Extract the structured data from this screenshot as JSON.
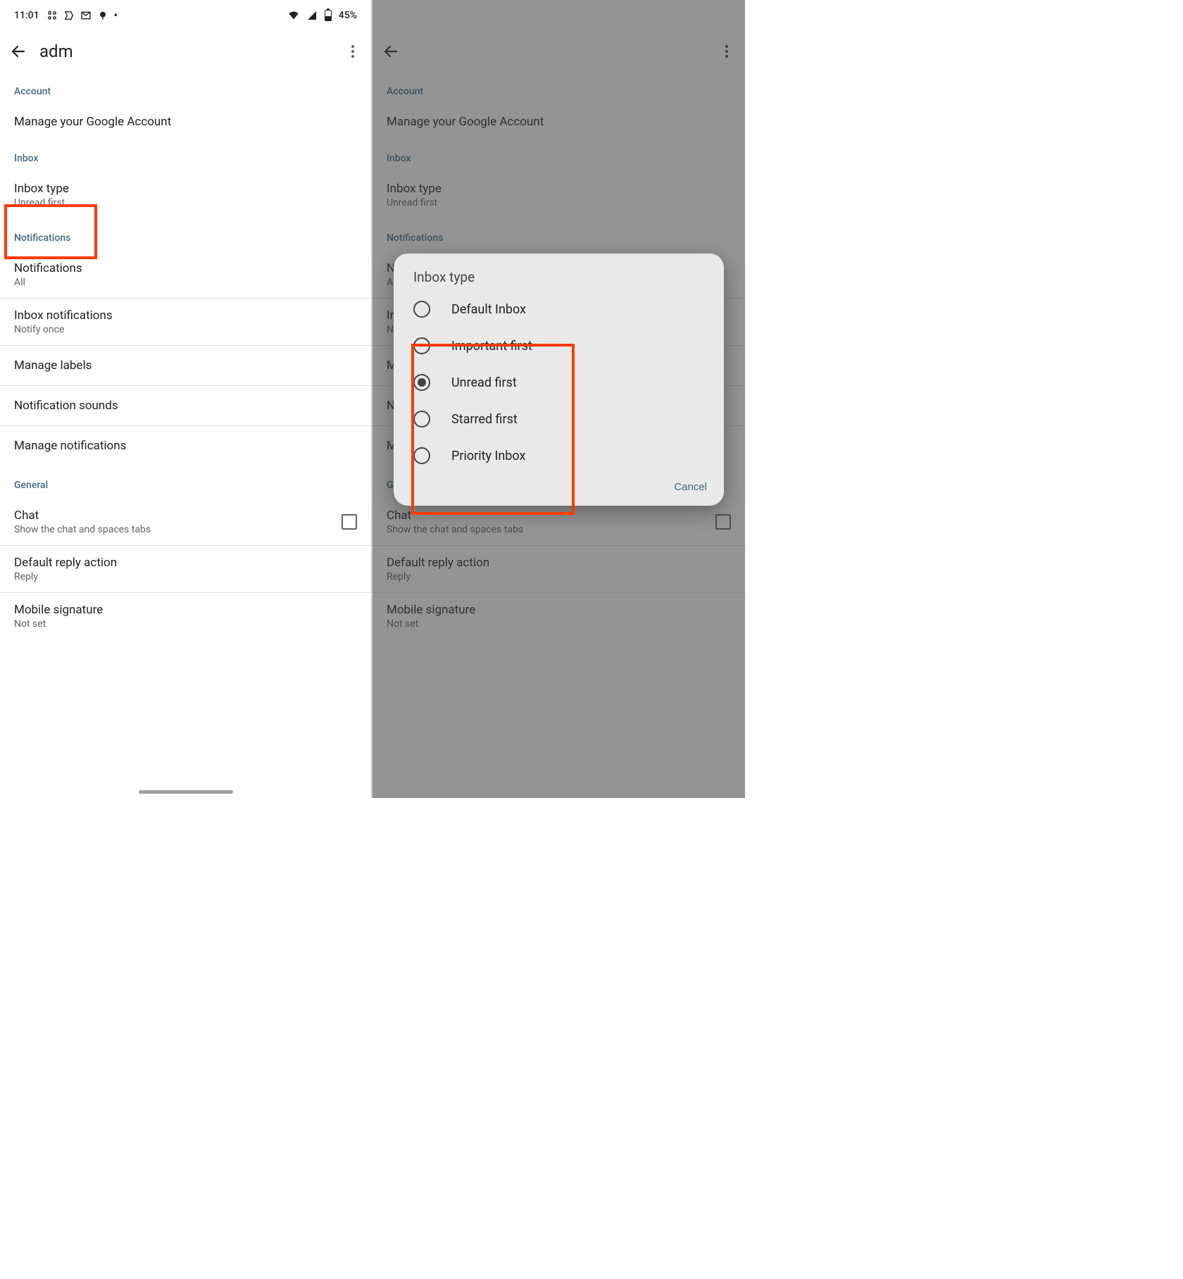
{
  "status": {
    "time": "11:01",
    "battery_text": "45%"
  },
  "appbar": {
    "title_truncated": "adm"
  },
  "sections": {
    "account": "Account",
    "inbox": "Inbox",
    "notifications": "Notifications",
    "general": "General"
  },
  "rows": {
    "manage_account": "Manage your Google Account",
    "inbox_type": {
      "title": "Inbox type",
      "sub": "Unread first"
    },
    "notifications": {
      "title": "Notifications",
      "sub": "All"
    },
    "inbox_notifications": {
      "title": "Inbox notifications",
      "sub": "Notify once"
    },
    "manage_labels": "Manage labels",
    "notification_sounds": "Notification sounds",
    "manage_notifications": "Manage notifications",
    "chat": {
      "title": "Chat",
      "sub": "Show the chat and spaces tabs"
    },
    "default_reply": {
      "title": "Default reply action",
      "sub": "Reply"
    },
    "mobile_signature": {
      "title": "Mobile signature",
      "sub": "Not set"
    }
  },
  "dialog": {
    "title": "Inbox type",
    "options": [
      "Default Inbox",
      "Important first",
      "Unread first",
      "Starred first",
      "Priority Inbox"
    ],
    "selected_index": 2,
    "cancel": "Cancel"
  }
}
